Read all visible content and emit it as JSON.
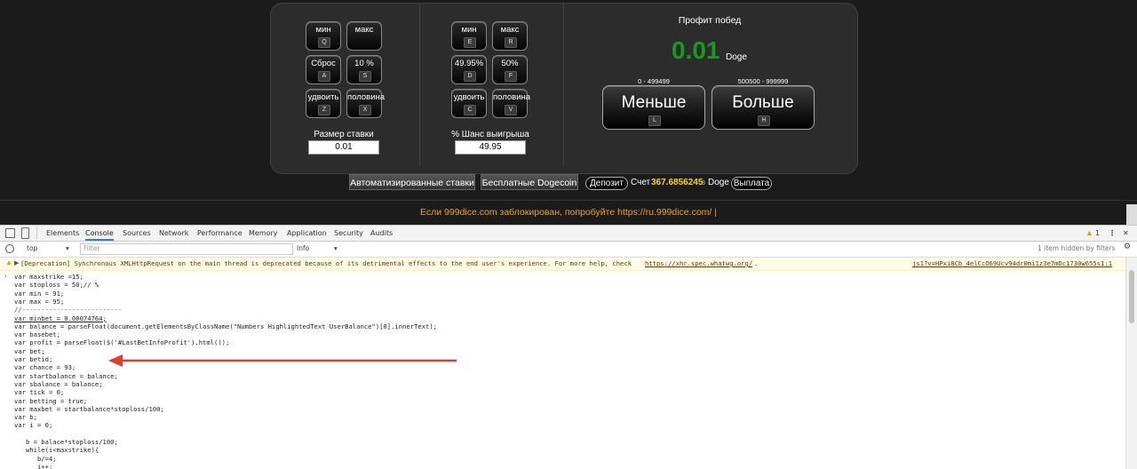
{
  "bet_panel": {
    "buttons": [
      {
        "label": "мин",
        "key": "Q"
      },
      {
        "label": "макс",
        "key": ""
      },
      {
        "label": "Сброс",
        "key": "A"
      },
      {
        "label": "10 %",
        "key": "S"
      },
      {
        "label": "удвоить",
        "key": "Z"
      },
      {
        "label": "половина",
        "key": "X"
      }
    ],
    "label": "Размер ставки",
    "value": "0.01"
  },
  "chance_panel": {
    "buttons": [
      {
        "label": "мин",
        "key": "E"
      },
      {
        "label": "макс",
        "key": "R"
      },
      {
        "label": "49.95%",
        "key": "D"
      },
      {
        "label": "50%",
        "key": "F"
      },
      {
        "label": "удвоить",
        "key": "C"
      },
      {
        "label": "половина",
        "key": "V"
      }
    ],
    "label": "% Шанс выигрыша",
    "value": "49.95"
  },
  "profit_panel": {
    "title": "Профит побед",
    "amount": "0.01",
    "currency": "Doge",
    "low_range": "0 - 499499",
    "high_range": "500500 - 999999",
    "low_button": {
      "label": "Меньше",
      "key": "L"
    },
    "high_button": {
      "label": "Больше",
      "key": "H"
    }
  },
  "bottom_bar": {
    "auto_bets": "Автоматизированные ставки",
    "free_doge": "Бесплатные Dogecoin",
    "deposit": "Депозит",
    "account_label": "Счет",
    "balance_main": "367.6856245",
    "balance_small": "8",
    "balance_currency": "Doge",
    "withdraw": "Выплата"
  },
  "notice": "Если 999dice.com заблокирован, попробуйте https://ru.999dice.com/ |",
  "devtools": {
    "tabs": [
      "Elements",
      "Console",
      "Sources",
      "Network",
      "Performance",
      "Memory",
      "Application",
      "Security",
      "Audits"
    ],
    "active_tab": "Console",
    "warning_count": "1",
    "context": "top",
    "filter_placeholder": "Filter",
    "level": "Info",
    "hidden_info": "1 item hidden by filters",
    "warning": {
      "text": "[Deprecation] Synchronous XMLHttpRequest on the main thread is deprecated because of its detrimental effects to the end user's experience. For more help, check",
      "link": "https://xhr.spec.whatwg.org/",
      "suffix": ".",
      "source": "js1?v=HPxi8Cb_4elCcO69Ucv94dr0mi1z3e7mDc1730w655s1:1"
    },
    "code_lines": [
      "var maxstrike =15;",
      "var stoploss = 50;// %",
      "var min = 91;",
      "var max = 95;",
      "//--------------------------",
      "var minbet = 0.00074764;",
      "var balance = parseFloat(document.getElementsByClassName(\"Numbers HighlightedText UserBalance\")[0].innerText);",
      "var basebet;",
      "var profit = parseFloat($('#LastBetInfoProfit').html());",
      "var bet;",
      "var betid;",
      "var chance = 93;",
      "var startbalance = balance;",
      "var sbalance = balance;",
      "var tick = 0;",
      "var betting = true;",
      "var maxbet = startbalance*stoploss/100;",
      "var b;",
      "var i = 0;",
      "",
      "   b = balace*stoploss/100;",
      "   while(i<maxstrike){",
      "      b/=4;",
      "      i++;"
    ]
  }
}
